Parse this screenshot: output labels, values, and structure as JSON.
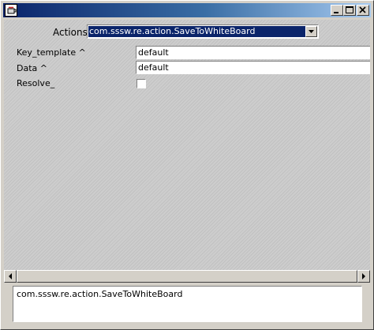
{
  "window": {
    "title": "",
    "controls": [
      "minimize-icon",
      "maximize-icon",
      "close-icon"
    ]
  },
  "actions": {
    "label": "Actions",
    "selected": "com.sssw.re.action.SaveToWhiteBoard"
  },
  "fields": [
    {
      "label": "Key_template ^",
      "value": "default"
    },
    {
      "label": "Data ^",
      "value": "default"
    }
  ],
  "resolve": {
    "label": "Resolve_",
    "checked": false
  },
  "status": {
    "text": "com.sssw.re.action.SaveToWhiteBoard"
  },
  "colors": {
    "titlebar": "#0a246a",
    "selection": "#0a246a",
    "face": "#d4d0c8"
  }
}
